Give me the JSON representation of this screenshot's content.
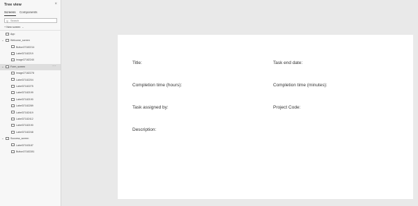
{
  "tree_view": {
    "title": "Tree view",
    "close_glyph": "×",
    "tabs": [
      {
        "label": "Screens",
        "active": true
      },
      {
        "label": "Components",
        "active": false
      }
    ],
    "search": {
      "placeholder": "Search",
      "value": ""
    },
    "new_screen_label": "New screen",
    "items": [
      {
        "label": "App",
        "icon": "app-icon",
        "level": 0,
        "expanded": null,
        "selected": false
      },
      {
        "label": "Welcome_screen",
        "icon": "screen-icon",
        "level": 0,
        "expanded": true,
        "selected": false
      },
      {
        "label": "Button37182214",
        "icon": "button-control-icon",
        "level": 1,
        "selected": false
      },
      {
        "label": "Label37182219",
        "icon": "label-control-icon",
        "level": 1,
        "selected": false
      },
      {
        "label": "Image37182240",
        "icon": "image-control-icon",
        "level": 1,
        "selected": false
      },
      {
        "label": "Form_screen",
        "icon": "screen-icon",
        "level": 0,
        "expanded": true,
        "selected": true
      },
      {
        "label": "Image27182278",
        "icon": "image-control-icon",
        "level": 1,
        "selected": false
      },
      {
        "label": "Label37182204",
        "icon": "label-control-icon",
        "level": 1,
        "selected": false
      },
      {
        "label": "Label37182275",
        "icon": "label-control-icon",
        "level": 1,
        "selected": false
      },
      {
        "label": "Label37182199",
        "icon": "label-control-icon",
        "level": 1,
        "selected": false
      },
      {
        "label": "Label37182190",
        "icon": "label-control-icon",
        "level": 1,
        "selected": false
      },
      {
        "label": "Label37182289",
        "icon": "label-control-icon",
        "level": 1,
        "selected": false
      },
      {
        "label": "Label37182419",
        "icon": "label-control-icon",
        "level": 1,
        "selected": false
      },
      {
        "label": "Label37182412",
        "icon": "label-control-icon",
        "level": 1,
        "selected": false
      },
      {
        "label": "Label37182190",
        "icon": "label-control-icon",
        "level": 1,
        "selected": false
      },
      {
        "label": "Label37182248",
        "icon": "label-control-icon",
        "level": 1,
        "selected": false
      },
      {
        "label": "Success_screen",
        "icon": "screen-icon",
        "level": 0,
        "expanded": true,
        "selected": false
      },
      {
        "label": "Label37163187",
        "icon": "label-control-icon",
        "level": 1,
        "selected": false
      },
      {
        "label": "Button37182281",
        "icon": "button-control-icon",
        "level": 1,
        "selected": false
      }
    ],
    "more_glyph": "···"
  },
  "form": {
    "title_label": "Title:",
    "task_end_date_label": "Task end date:",
    "completion_hours_label": "Completion time (hours):",
    "completion_minutes_label": "Completion time (minutes):",
    "task_assigned_by_label": "Task assigned by:",
    "project_code_label": "Project Code:",
    "description_label": "Description:"
  }
}
